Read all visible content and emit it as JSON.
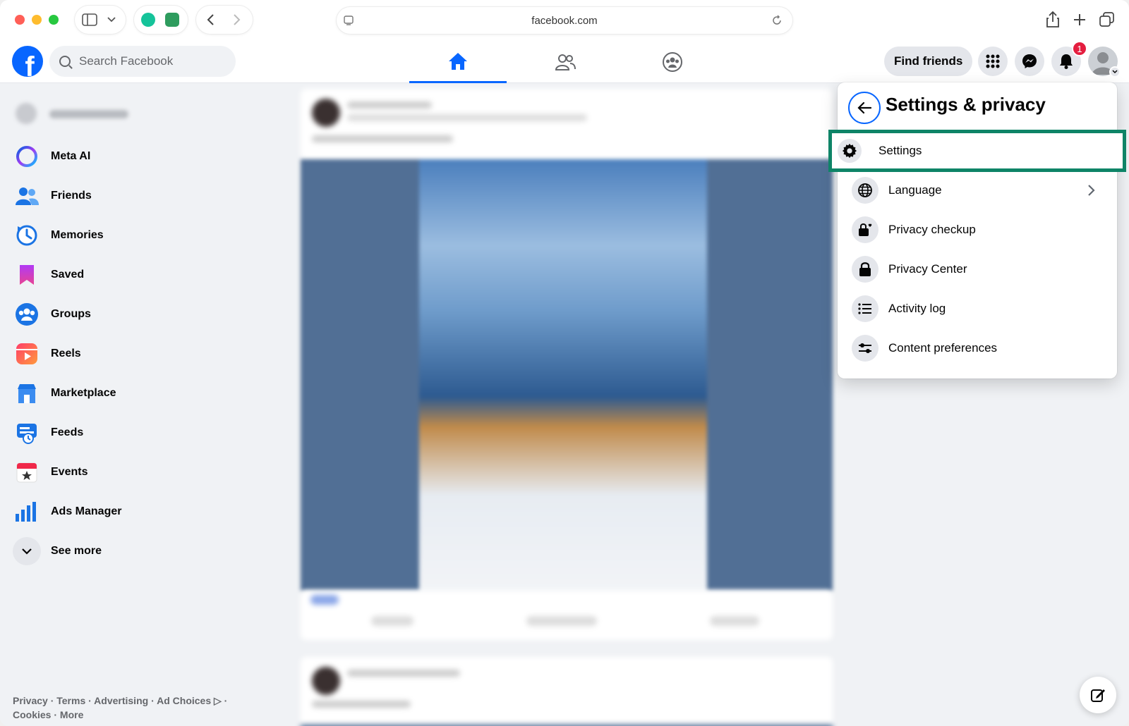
{
  "browser": {
    "url": "facebook.com"
  },
  "header": {
    "search_placeholder": "Search Facebook",
    "find_friends_label": "Find friends",
    "notification_count": "1"
  },
  "sidebar": {
    "items": [
      {
        "label": "Meta AI",
        "icon": "meta-ai-icon"
      },
      {
        "label": "Friends",
        "icon": "friends-icon"
      },
      {
        "label": "Memories",
        "icon": "memories-icon"
      },
      {
        "label": "Saved",
        "icon": "saved-icon"
      },
      {
        "label": "Groups",
        "icon": "groups-icon"
      },
      {
        "label": "Reels",
        "icon": "reels-icon"
      },
      {
        "label": "Marketplace",
        "icon": "marketplace-icon"
      },
      {
        "label": "Feeds",
        "icon": "feeds-icon"
      },
      {
        "label": "Events",
        "icon": "events-icon"
      },
      {
        "label": "Ads Manager",
        "icon": "ads-manager-icon"
      },
      {
        "label": "See more",
        "icon": "chevron-down-icon"
      }
    ],
    "footer_line1": "Privacy · Terms · Advertising · Ad Choices ▷ ·",
    "footer_line2": "Cookies · More"
  },
  "settings_menu": {
    "title": "Settings & privacy",
    "items": [
      {
        "label": "Settings",
        "icon": "gear-icon"
      },
      {
        "label": "Language",
        "icon": "globe-icon"
      },
      {
        "label": "Privacy checkup",
        "icon": "lock-heart-icon"
      },
      {
        "label": "Privacy Center",
        "icon": "lock-icon"
      },
      {
        "label": "Activity log",
        "icon": "list-icon"
      },
      {
        "label": "Content preferences",
        "icon": "sliders-icon"
      }
    ]
  },
  "colors": {
    "brand": "#0866ff",
    "highlight_border": "#0e8467",
    "badge": "#e41e3f"
  }
}
